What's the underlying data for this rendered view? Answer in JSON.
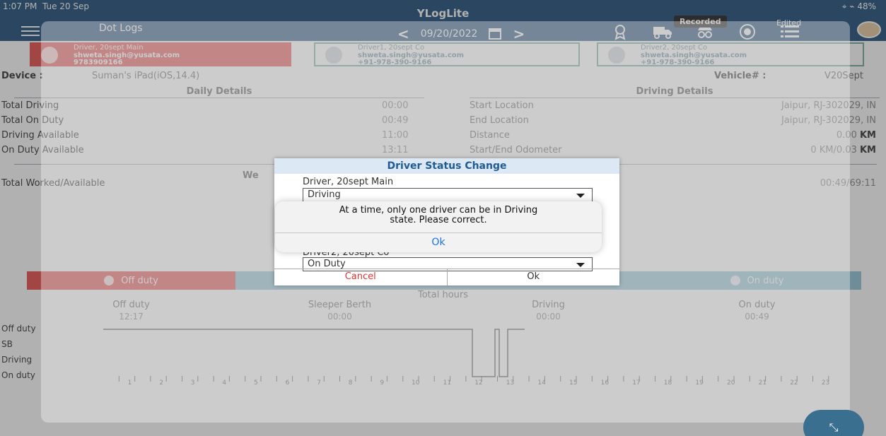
{
  "status_bar": {
    "time": "1:07 PM",
    "date": "Tue 20 Sep",
    "right": "⌖ ⌁ 48%"
  },
  "app": {
    "title": "YLogLite",
    "page_title": "Dot Logs"
  },
  "header": {
    "date": "09/20/2022",
    "recorded_badge": "Recorded",
    "edited_label": "Edited",
    "icons": [
      "award-icon",
      "truck-icon",
      "incognito-icon",
      "eld-icon",
      "list-icon"
    ]
  },
  "drivers": [
    {
      "name": "Driver, 20sept Main",
      "email": "shweta.singh@yusata.com",
      "phone": "9783909166",
      "active": true
    },
    {
      "name": "Driver1, 20sept Co",
      "email": "shweta.singh@yusata.com",
      "phone": "+91-978-390-9166",
      "active": false
    },
    {
      "name": "Driver2, 20sept Co",
      "email": "shweta.singh@yusata.com",
      "phone": "+91-978-390-9166",
      "active": false
    }
  ],
  "device": {
    "label": "Device :",
    "value": "Suman's iPad(iOS,14.4)"
  },
  "vehicle": {
    "label": "Vehicle# :",
    "value": "V20Sept"
  },
  "daily": {
    "title": "Daily Details",
    "rows": [
      {
        "label": "Total Driving",
        "value": "00:00"
      },
      {
        "label": "Total On Duty",
        "value": "00:49"
      },
      {
        "label": "Driving Available",
        "value": "11:00"
      },
      {
        "label": "On Duty Available",
        "value": "13:11"
      }
    ]
  },
  "driving": {
    "title": "Driving Details",
    "rows": [
      {
        "label": "Start Location",
        "value": "Jaipur, RJ-302029, IN",
        "unit": ""
      },
      {
        "label": "End Location",
        "value": "Jaipur, RJ-302029, IN",
        "unit": ""
      },
      {
        "label": "Distance",
        "value": "0.00 ",
        "unit": "KM"
      },
      {
        "label": "Start/End Odometer",
        "value": "0 KM/0.03 ",
        "unit": "KM"
      }
    ]
  },
  "weekly": {
    "title": "We",
    "label": "Total Worked/Available",
    "value": "00:49/69:11"
  },
  "status_tabs": [
    "Off duty",
    "",
    "",
    "On duty"
  ],
  "totals": {
    "title": "Total hours",
    "cols": [
      {
        "label": "Off duty",
        "value": "12:17"
      },
      {
        "label": "Sleeper Berth",
        "value": "00:00"
      },
      {
        "label": "Driving",
        "value": "00:00"
      },
      {
        "label": "On duty",
        "value": "00:49"
      }
    ]
  },
  "graph": {
    "rows": [
      "Off duty",
      "SB",
      "Driving",
      "On duty"
    ],
    "hours": [
      "1",
      "2",
      "3",
      "4",
      "5",
      "6",
      "7",
      "8",
      "9",
      "10",
      "11",
      "12",
      "13",
      "14",
      "15",
      "16",
      "17",
      "18",
      "19",
      "20",
      "21",
      "22",
      "23"
    ]
  },
  "dialog": {
    "title": "Driver Status Change",
    "driver1_label": "Driver, 20sept Main",
    "driver1_status": "Driving",
    "driver2_label": "Driver2, 20sept Co",
    "driver2_status": "On Duty",
    "cancel": "Cancel",
    "ok": "Ok"
  },
  "alert": {
    "message": "At a time, only one driver can be in Driving state. Please correct.",
    "ok": "Ok"
  }
}
